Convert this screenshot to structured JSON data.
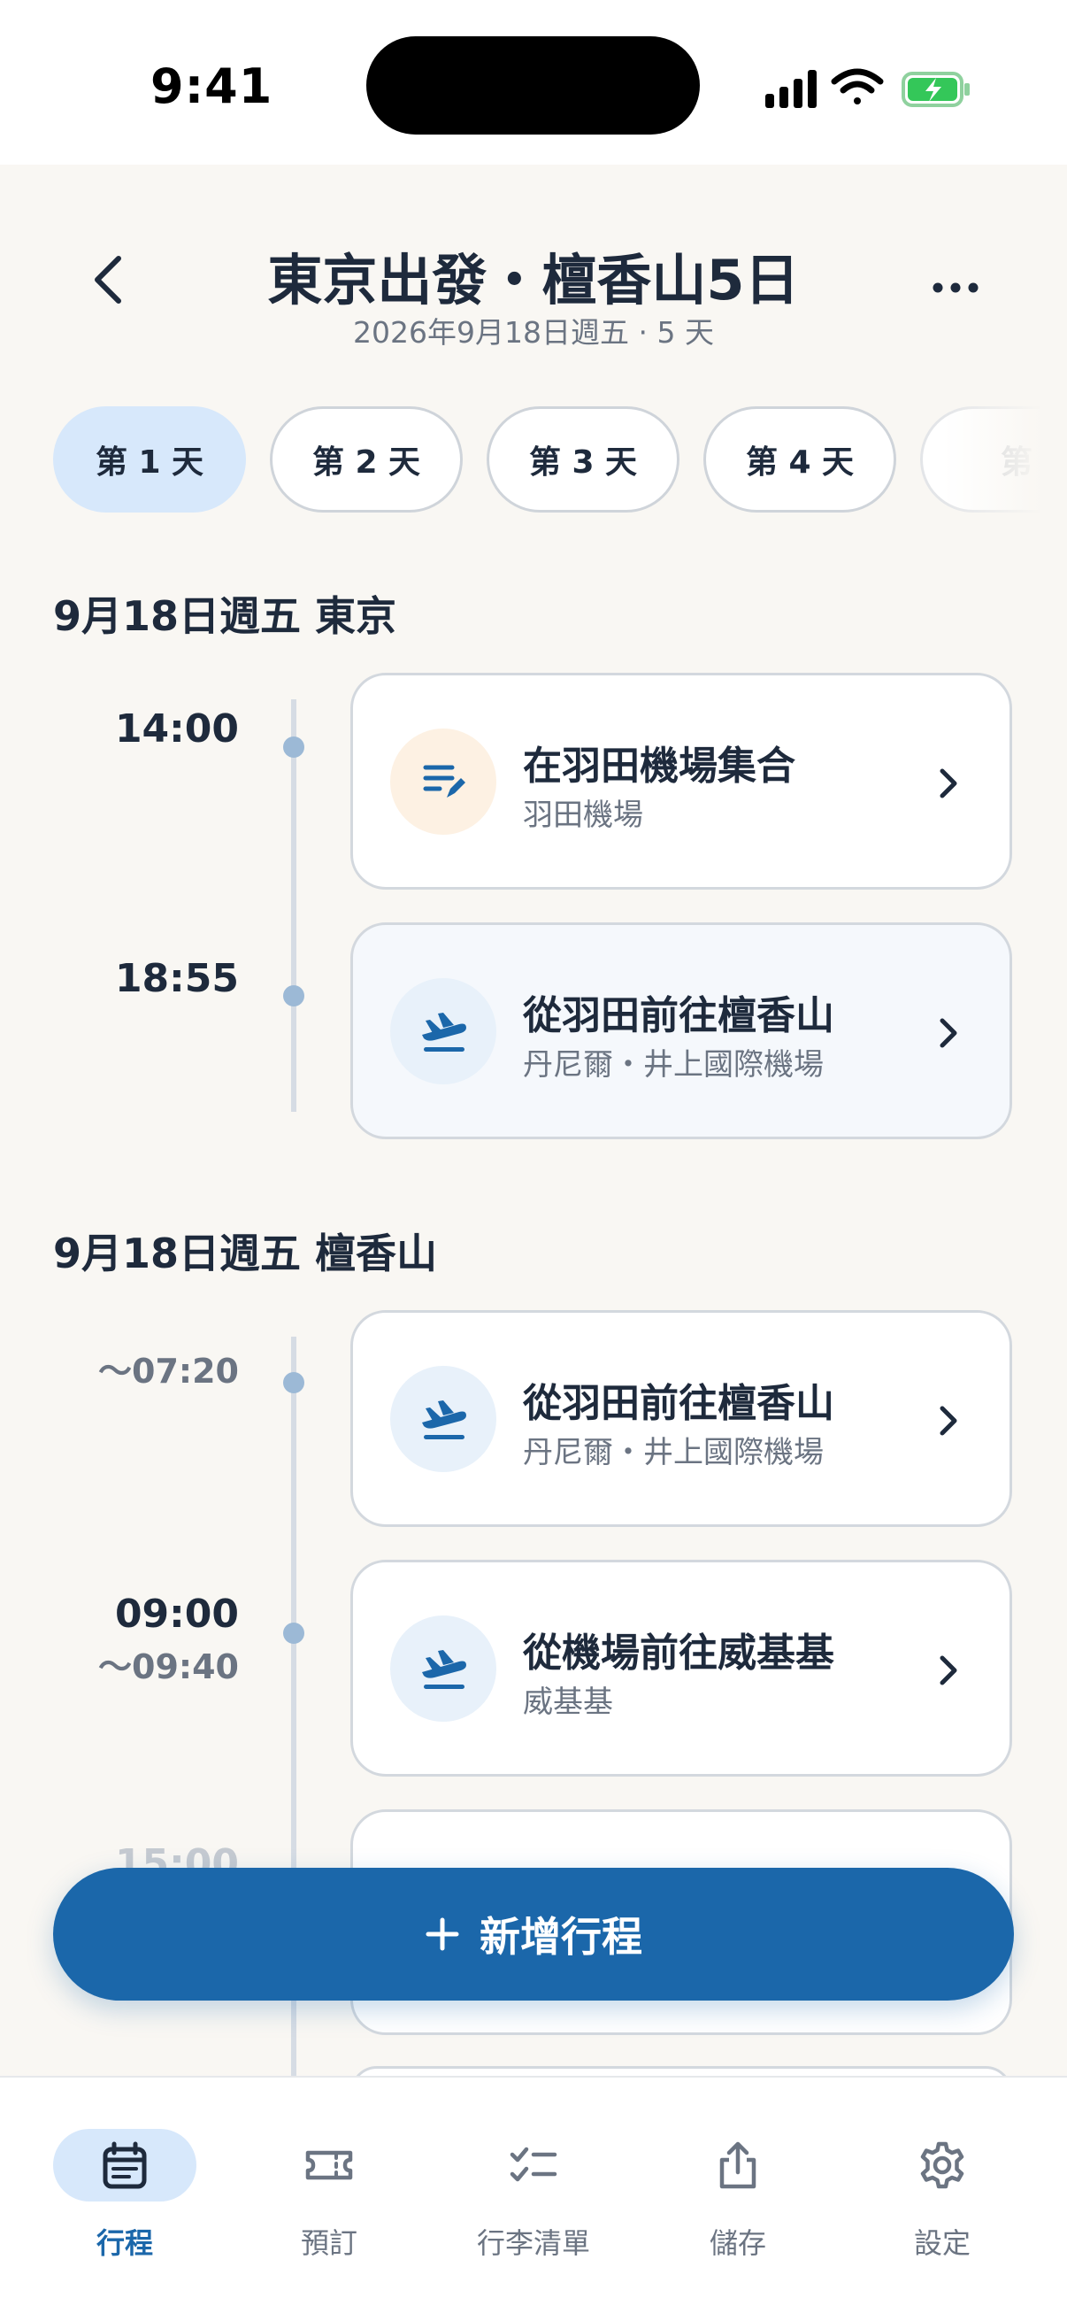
{
  "status": {
    "time": "9:41"
  },
  "header": {
    "title": "東京出發・檀香山5日",
    "subtitle": "2026年9月18日週五 · 5 天"
  },
  "tabs": [
    {
      "label": "第 1 天",
      "active": true
    },
    {
      "label": "第 2 天"
    },
    {
      "label": "第 3 天"
    },
    {
      "label": "第 4 天"
    },
    {
      "label": "第"
    }
  ],
  "sections": [
    {
      "title": "9月18日週五  東京",
      "items": [
        {
          "time": "14:00",
          "title": "在羽田機場集合",
          "subtitle": "羽田機場",
          "icon": "note-edit-icon"
        },
        {
          "time": "18:55",
          "title": "從羽田前往檀香山",
          "subtitle": "丹尼爾・井上國際機場",
          "icon": "plane-departure-icon"
        }
      ]
    },
    {
      "title": "9月18日週五  檀香山",
      "items": [
        {
          "time_sub": "〜07:20",
          "title": "從羽田前往檀香山",
          "subtitle": "丹尼爾・井上國際機場",
          "icon": "plane-departure-icon"
        },
        {
          "time": "09:00",
          "time_sub": "〜09:40",
          "title": "從機場前往威基基",
          "subtitle": "威基基",
          "icon": "plane-departure-icon"
        }
      ],
      "partial_time": "15:00"
    }
  ],
  "fab": {
    "label": "新增行程"
  },
  "nav": [
    {
      "label": "行程",
      "icon": "calendar-icon",
      "active": true
    },
    {
      "label": "預訂",
      "icon": "ticket-icon"
    },
    {
      "label": "行李清單",
      "icon": "checklist-icon"
    },
    {
      "label": "儲存",
      "icon": "share-icon"
    },
    {
      "label": "設定",
      "icon": "gear-icon"
    }
  ],
  "colors": {
    "accent": "#1b67aa",
    "active_bg": "#d7e8fb",
    "background": "#f9f7f3"
  }
}
